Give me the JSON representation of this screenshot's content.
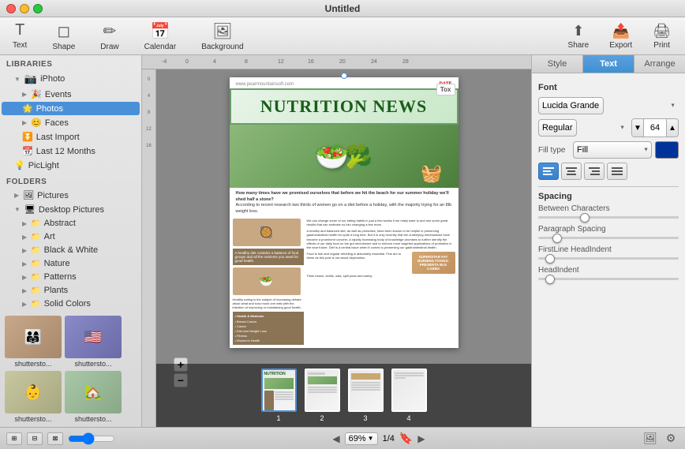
{
  "window": {
    "title": "Untitled"
  },
  "toolbar": {
    "items": [
      {
        "id": "text",
        "label": "Text",
        "icon": "T"
      },
      {
        "id": "shape",
        "label": "Shape",
        "icon": "◻"
      },
      {
        "id": "draw",
        "label": "Draw",
        "icon": "✏"
      },
      {
        "id": "calendar",
        "label": "Calendar",
        "icon": "📅"
      },
      {
        "id": "background",
        "label": "Background",
        "icon": "🖼"
      }
    ],
    "right_items": [
      {
        "id": "share",
        "label": "Share",
        "icon": "⬆"
      },
      {
        "id": "export",
        "label": "Export",
        "icon": "📤"
      },
      {
        "id": "print",
        "label": "Print",
        "icon": "🖨"
      }
    ]
  },
  "sidebar": {
    "libraries_header": "LIBRARIES",
    "libraries": [
      {
        "id": "iphoto",
        "label": "iPhoto",
        "indent": 0,
        "has_triangle": true,
        "expanded": true
      },
      {
        "id": "events",
        "label": "Events",
        "indent": 1,
        "has_triangle": true
      },
      {
        "id": "photos",
        "label": "Photos",
        "indent": 1,
        "selected": true
      },
      {
        "id": "faces",
        "label": "Faces",
        "indent": 1,
        "has_triangle": true
      },
      {
        "id": "last-import",
        "label": "Last Import",
        "indent": 1
      },
      {
        "id": "last-12-months",
        "label": "Last 12 Months",
        "indent": 1
      },
      {
        "id": "piclight",
        "label": "PicLight",
        "indent": 0
      }
    ],
    "folders_header": "FOLDERS",
    "folders": [
      {
        "id": "pictures",
        "label": "Pictures",
        "indent": 0,
        "has_triangle": true
      },
      {
        "id": "desktop",
        "label": "Desktop Pictures",
        "indent": 0,
        "has_triangle": true,
        "expanded": true
      },
      {
        "id": "abstract",
        "label": "Abstract",
        "indent": 1,
        "has_triangle": true
      },
      {
        "id": "art",
        "label": "Art",
        "indent": 1,
        "has_triangle": true
      },
      {
        "id": "black-white",
        "label": "Black & White",
        "indent": 1,
        "has_triangle": true
      },
      {
        "id": "nature",
        "label": "Nature",
        "indent": 1,
        "has_triangle": true
      },
      {
        "id": "patterns",
        "label": "Patterns",
        "indent": 1,
        "has_triangle": true
      },
      {
        "id": "plants",
        "label": "Plants",
        "indent": 1,
        "has_triangle": true
      },
      {
        "id": "solid-colors",
        "label": "Solid Colors",
        "indent": 1,
        "has_triangle": true
      }
    ],
    "thumbnails": [
      {
        "id": "thumb1",
        "label": "shuttersto...",
        "emoji": "👨‍👩‍👧"
      },
      {
        "id": "thumb2",
        "label": "shuttersto...",
        "emoji": "🇺🇸"
      },
      {
        "id": "thumb3",
        "label": "shuttersto...",
        "emoji": "👶"
      },
      {
        "id": "thumb4",
        "label": "shuttersto...",
        "emoji": "🏡"
      }
    ]
  },
  "document": {
    "website": "www.pearmountainsoft.com",
    "date_label": "DATE",
    "title": "NUTRITION NEWS",
    "intro_text": "How many times have we promised ourselves that before we hit the beach for our summer holiday we'll shed half a stone? According to recent research two thirds of women go on a diet before a holiday, with the majority trying for an 8lb weight loss.",
    "body_text": "We can change some of our eating habits in just a few weeks if we really want to and see some great results that can motivate us into changing a few more.",
    "tox_label": "Tox"
  },
  "page_thumbnails": [
    {
      "num": "1",
      "active": true
    },
    {
      "num": "2",
      "active": false
    },
    {
      "num": "3",
      "active": false
    },
    {
      "num": "4",
      "active": false
    }
  ],
  "right_panel": {
    "tabs": [
      {
        "id": "style",
        "label": "Style"
      },
      {
        "id": "text",
        "label": "Text",
        "active": true
      },
      {
        "id": "arrange",
        "label": "Arrange"
      }
    ],
    "font_section": "Font",
    "font_family": "Lucida Grande",
    "font_style": "Regular",
    "font_size": "64",
    "fill_type_label": "Fill type",
    "fill_type_value": "Fill",
    "fill_color": "#003399",
    "align_buttons": [
      {
        "id": "align-left",
        "icon": "≡",
        "active": true
      },
      {
        "id": "align-center",
        "icon": "≡",
        "active": false
      },
      {
        "id": "align-right",
        "icon": "≡",
        "active": false
      },
      {
        "id": "align-justify",
        "icon": "≡",
        "active": false
      }
    ],
    "spacing_section": "Spacing",
    "spacing_items": [
      {
        "id": "between-chars",
        "label": "Between Characters"
      },
      {
        "id": "paragraph",
        "label": "Paragraph Spacing"
      },
      {
        "id": "firstline",
        "label": "FirstLine HeadIndent"
      },
      {
        "id": "headindent",
        "label": "HeadIndent"
      }
    ]
  },
  "status_bar": {
    "zoom_level": "69%",
    "page_current": "1",
    "page_total": "4"
  }
}
